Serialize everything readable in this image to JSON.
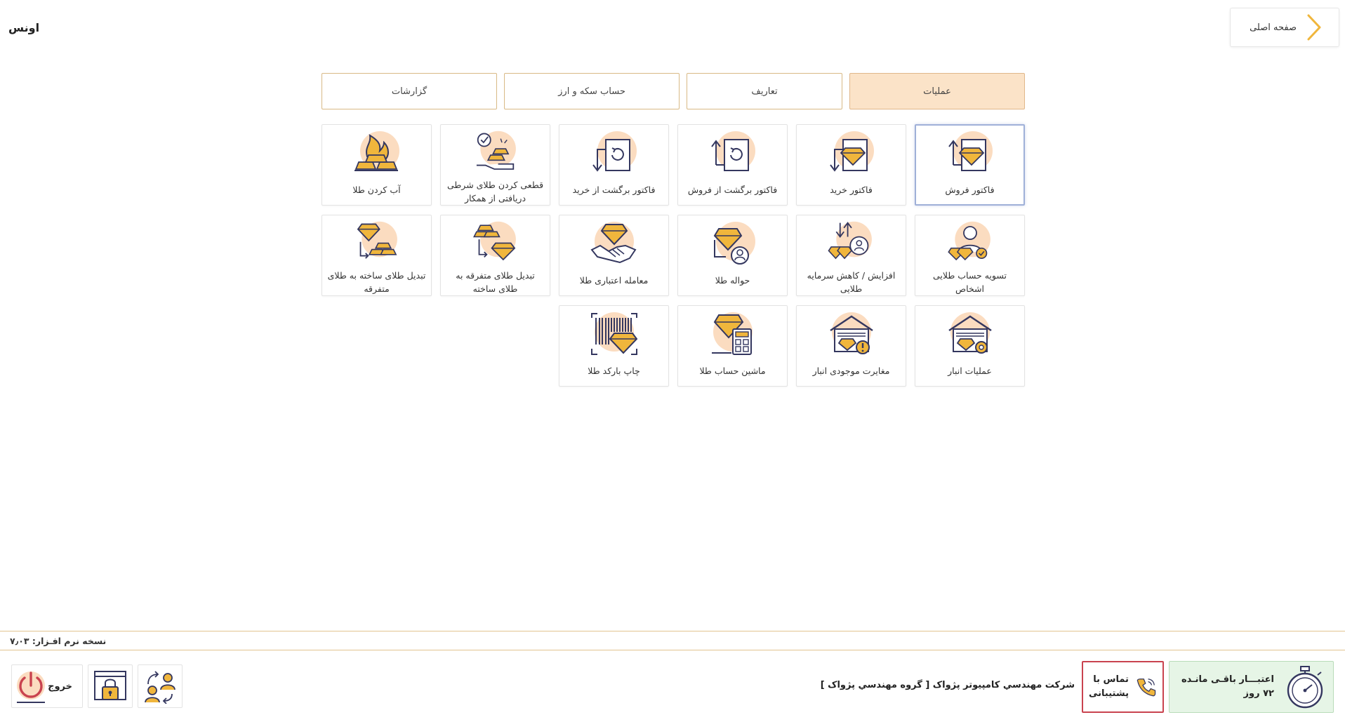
{
  "app": {
    "title": "اونس"
  },
  "header": {
    "home_label": "صفحه اصلی"
  },
  "tabs": [
    {
      "label": "عملیات",
      "active": true
    },
    {
      "label": "تعاریف",
      "active": false
    },
    {
      "label": "حساب سکه و ارز",
      "active": false
    },
    {
      "label": "گزارشات",
      "active": false
    }
  ],
  "cards": {
    "sales_invoice": "فاکتور فروش",
    "purchase_invoice": "فاکتور خرید",
    "sales_return": "فاکتور برگشت از فروش",
    "purchase_return": "فاکتور برگشت از خرید",
    "finalize_conditional": "قطعی کردن طلای شرطی دریافتی از همکار",
    "melt_gold": "آب کردن طلا",
    "settle_gold_account": "تسویه حساب طلایی اشخاص",
    "gold_capital": "افزایش / کاهش سرمایه طلایی",
    "gold_transfer": "حواله طلا",
    "credit_trade": "معامله اعتباری طلا",
    "misc_to_made": "تبدیل طلای متفرقه به طلای ساخته",
    "made_to_misc": "تبدیل طلای ساخته به طلای متفرقه",
    "warehouse_ops": "عملیات انبار",
    "inventory_mismatch": "مغایرت موجودی انبار",
    "gold_calculator": "ماشین حساب طلا",
    "print_barcode": "چاپ بارکد طلا"
  },
  "version": {
    "text": "نسخه نرم افـزار: ۷٫۰۳"
  },
  "footer": {
    "credit_line1": "اعتبـــار باقـی مانـده",
    "credit_line2": "۷۲ روز",
    "support_line1": "تماس با",
    "support_line2": "پشتیبانی",
    "company": "شرکت مهندسي کامپيوتر پژواک [ گروه مهندسي پژواک ]",
    "exit_label": "خروج"
  },
  "colors": {
    "accent": "#f0b63c",
    "active_tab": "#fbe3c8",
    "navy": "#34375f",
    "peach": "#fbdcc0",
    "credit_bg": "#e6f5e6",
    "support_border": "#c9434f"
  }
}
